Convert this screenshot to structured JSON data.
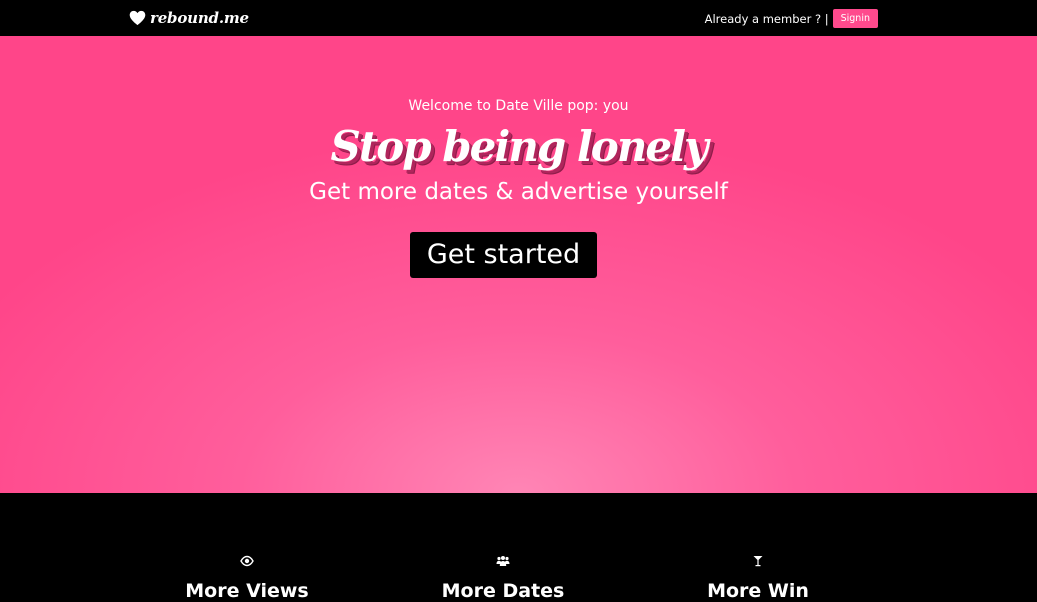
{
  "navbar": {
    "brand": "rebound.me",
    "member_text": "Already a member ? |",
    "signin_label": "Signin"
  },
  "hero": {
    "welcome": "Welcome to Date Ville pop: you",
    "headline": "Stop being lonely",
    "subline": "Get more dates & advertise yourself",
    "cta_label": "Get started"
  },
  "features": [
    {
      "icon": "eye-icon",
      "title": "More Views"
    },
    {
      "icon": "users-icon",
      "title": "More Dates"
    },
    {
      "icon": "cocktail-icon",
      "title": "More Win"
    }
  ],
  "colors": {
    "accent": "#ff4a8d",
    "hero_bg": "#ff4f8f",
    "hero_glow": "#ff85b5",
    "dark": "#000000",
    "headline_shadow": "#b0255c"
  }
}
